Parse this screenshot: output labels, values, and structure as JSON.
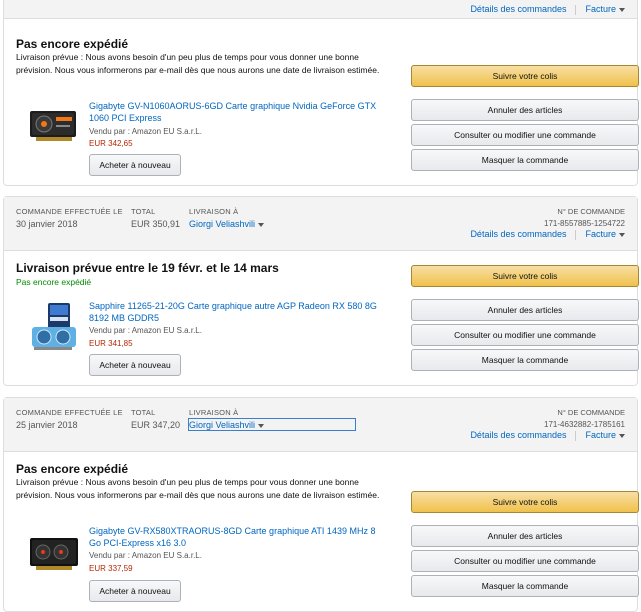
{
  "header_links": {
    "details": "Détails des commandes",
    "invoice": "Facture"
  },
  "labels": {
    "ordered": "COMMANDE EFFECTUÉE LE",
    "total": "TOTAL",
    "ship_to": "LIVRAISON À",
    "order_no": "N° DE COMMANDE"
  },
  "buttons": {
    "track": "Suivre votre colis",
    "cancel": "Annuler des articles",
    "view_edit": "Consulter ou modifier une commande",
    "hide": "Masquer la commande",
    "rebuy": "Acheter à nouveau"
  },
  "orders": [
    {
      "status": "Pas encore expédié",
      "note": "Livraison prévue : Nous avons besoin d'un peu plus de temps pour vous donner une bonne prévision. Nous vous informerons par e-mail dès que nous aurons une date de livraison estimée.",
      "item": {
        "title": "Gigabyte GV-N1060AORUS-6GD Carte graphique Nvidia GeForce GTX 1060 PCI Express",
        "seller": "Vendu par : Amazon EU S.a.r.L.",
        "price": "EUR 342,65"
      }
    },
    {
      "date": "30 janvier 2018",
      "total": "EUR 350,91",
      "recipient": "Giorgi Veliashvili",
      "order_no": "171-8557885-1254722",
      "status": "Livraison prévue entre le 19 févr. et le 14 mars",
      "substatus": "Pas encore expédié",
      "item": {
        "title": "Sapphire 11265-21-20G Carte graphique autre AGP Radeon RX 580 8G 8192 MB GDDR5",
        "seller": "Vendu par : Amazon EU S.a.r.L.",
        "price": "EUR 341,85"
      }
    },
    {
      "date": "25 janvier 2018",
      "total": "EUR 347,20",
      "recipient": "Giorgi Veliashvili",
      "order_no": "171-4632882-1785161",
      "status": "Pas encore expédié",
      "note": "Livraison prévue : Nous avons besoin d'un peu plus de temps pour vous donner une bonne prévision. Nous vous informerons par e-mail dès que nous aurons une date de livraison estimée.",
      "item": {
        "title": "Gigabyte GV-RX580XTRAORUS-8GD Carte graphique ATI 1439 MHz 8 Go PCI-Express x16 3.0",
        "seller": "Vendu par : Amazon EU S.a.r.L.",
        "price": "EUR 337,59"
      }
    }
  ]
}
